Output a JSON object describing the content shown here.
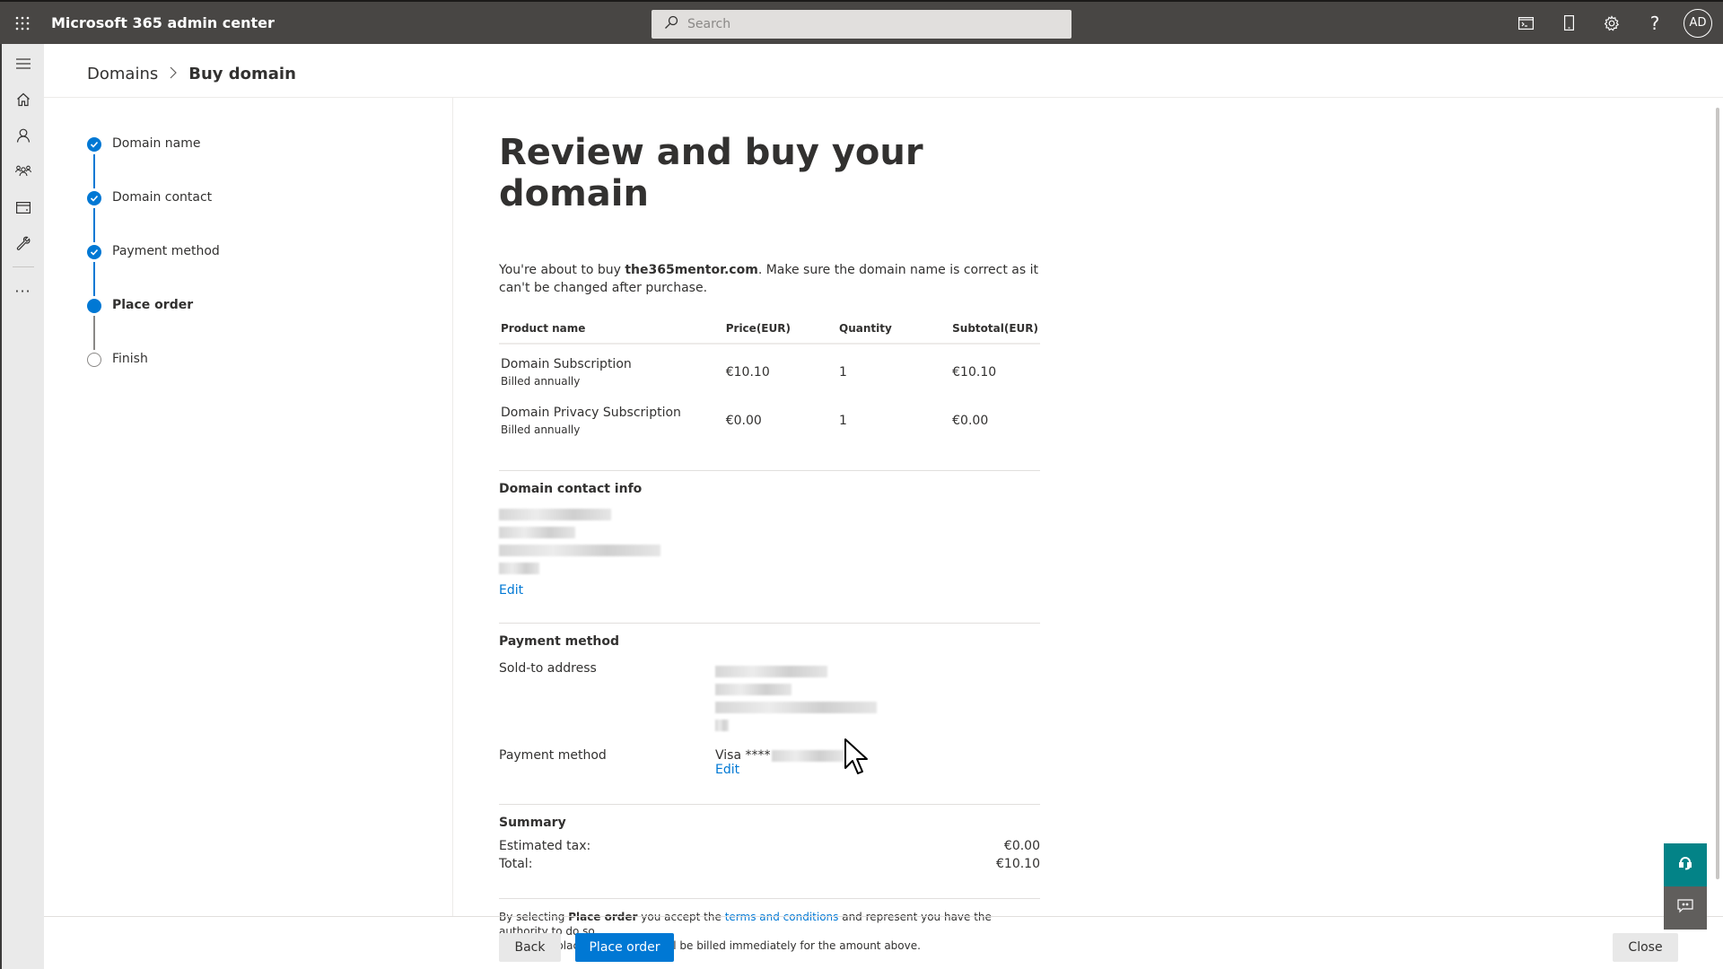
{
  "topbar": {
    "app_title": "Microsoft 365 admin center",
    "search_placeholder": "Search",
    "avatar_initials": "AD",
    "icons": [
      "terminal-icon",
      "mobile-icon",
      "gear-icon",
      "help-icon"
    ]
  },
  "leftnav": {
    "items": [
      "hamburger-icon",
      "home-icon",
      "user-icon",
      "group-icon",
      "billing-icon",
      "setup-icon",
      "more-icon"
    ]
  },
  "breadcrumb": {
    "parent": "Domains",
    "current": "Buy domain"
  },
  "stepper": {
    "steps": [
      {
        "label": "Domain name",
        "state": "done"
      },
      {
        "label": "Domain contact",
        "state": "done"
      },
      {
        "label": "Payment method",
        "state": "done"
      },
      {
        "label": "Place order",
        "state": "current"
      },
      {
        "label": "Finish",
        "state": "future"
      }
    ]
  },
  "main": {
    "title": "Review and buy your domain",
    "intro_prefix": "You're about to buy ",
    "domain": "the365mentor.com",
    "intro_suffix": ". Make sure the domain name is correct as it can't be changed after purchase.",
    "table": {
      "headers": [
        "Product name",
        "Price(EUR)",
        "Quantity",
        "Subtotal(EUR)"
      ],
      "rows": [
        {
          "name": "Domain Subscription",
          "billing": "Billed annually",
          "price": "€10.10",
          "quantity": "1",
          "subtotal": "€10.10"
        },
        {
          "name": "Domain Privacy Subscription",
          "billing": "Billed annually",
          "price": "€0.00",
          "quantity": "1",
          "subtotal": "€0.00"
        }
      ]
    },
    "contact": {
      "title": "Domain contact info",
      "edit_label": "Edit"
    },
    "payment": {
      "title": "Payment method",
      "sold_to_label": "Sold-to address",
      "method_label": "Payment method",
      "method_value": "Visa ****",
      "edit_label": "Edit"
    },
    "summary": {
      "title": "Summary",
      "tax_label": "Estimated tax:",
      "tax_value": "€0.00",
      "total_label": "Total:",
      "total_value": "€10.10"
    },
    "legal": {
      "prefix": "By selecting ",
      "bold": "Place order",
      "middle": " you accept the ",
      "link": "terms and conditions",
      "suffix": " and represent you have the authority to do so.",
      "line2": "When you place this order, you'll be billed immediately for the amount above."
    }
  },
  "footer": {
    "back_label": "Back",
    "place_order_label": "Place order",
    "close_label": "Close"
  },
  "colors": {
    "accent": "#0078d4",
    "topbar": "#484644",
    "help_button": "#038387",
    "chat_button": "#605e5c"
  }
}
